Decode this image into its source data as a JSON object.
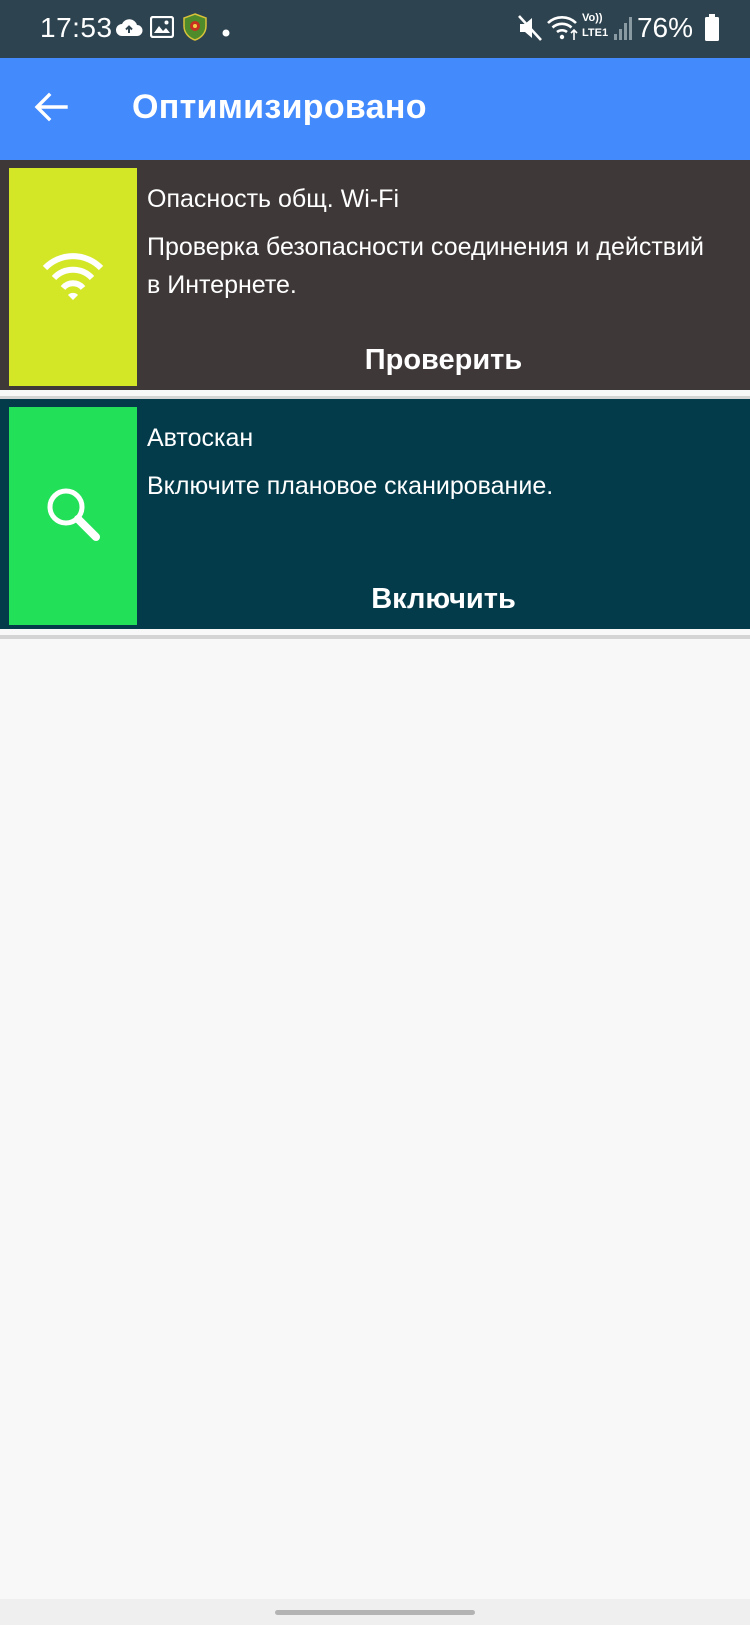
{
  "status_bar": {
    "time": "17:53",
    "left_icons": [
      "cloud-upload-icon",
      "image-icon",
      "shield-app-icon",
      "dot-icon"
    ],
    "right_icons": [
      "mute-icon",
      "wifi-icon",
      "volte-lte-icon",
      "signal-icon",
      "battery-icon"
    ],
    "network_label_top": "Vo))",
    "network_label_bottom": "LTE1",
    "battery_percent": "76%"
  },
  "app_bar": {
    "title": "Оптимизировано",
    "back_icon": "arrow-back-icon",
    "color": "#438afd"
  },
  "cards": [
    {
      "title": "Опасность общ. Wi-Fi",
      "description": "Проверка безопасности соединения и действий в Интернете.",
      "action_label": "Проверить",
      "icon": "wifi-icon",
      "tile_color": "#d4e727",
      "background": "#3f3838"
    },
    {
      "title": "Автоскан",
      "description": "Включите плановое сканирование.",
      "action_label": "Включить",
      "icon": "search-icon",
      "tile_color": "#22e058",
      "background": "#043b4b"
    }
  ]
}
